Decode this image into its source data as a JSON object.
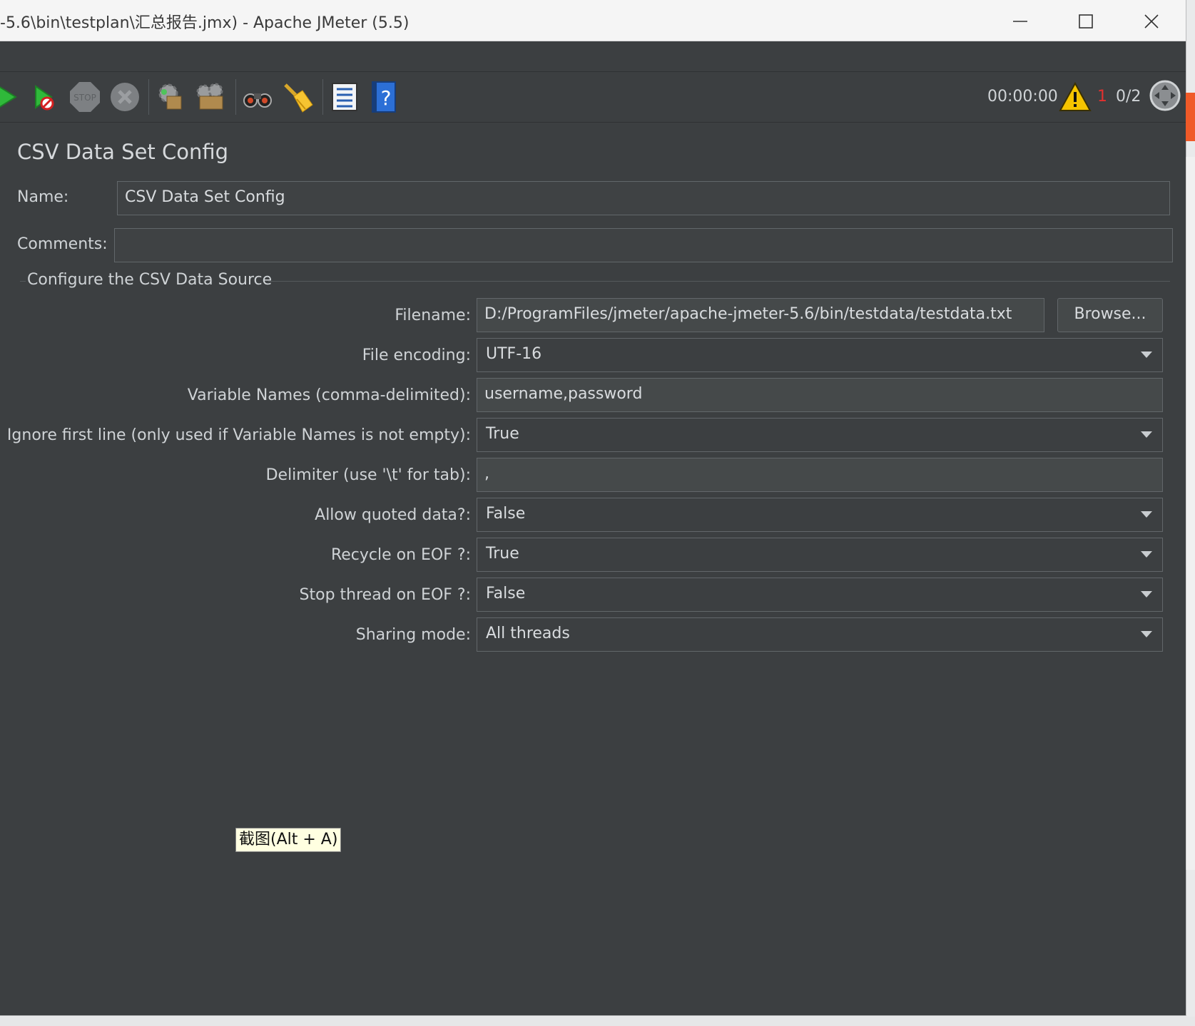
{
  "window": {
    "title": "-5.6\\bin\\testplan\\汇总报告.jmx) - Apache JMeter (5.5)",
    "controls": [
      "minimize",
      "maximize",
      "close"
    ]
  },
  "toolbar": {
    "buttons": [
      "start-icon",
      "start-no-pauses-icon",
      "stop-icon",
      "shutdown-icon",
      "clear-icon",
      "clear-all-icon",
      "search-icon",
      "reset-search-icon",
      "function-helper-icon",
      "help-icon"
    ],
    "timer": "00:00:00",
    "error_count": "1",
    "threads": "0/2"
  },
  "panel": {
    "heading": "CSV Data Set Config",
    "name_label": "Name:",
    "name_value": "CSV Data Set Config",
    "comments_label": "Comments:",
    "comments_value": "",
    "group_title": "Configure the CSV Data Source",
    "fields": {
      "filename": {
        "label": "Filename:",
        "value": "D:/ProgramFiles/jmeter/apache-jmeter-5.6/bin/testdata/testdata.txt"
      },
      "browse_label": "Browse...",
      "encoding": {
        "label": "File encoding:",
        "value": "UTF-16"
      },
      "variable_names": {
        "label": "Variable Names (comma-delimited):",
        "value": "username,password"
      },
      "ignore_first_line": {
        "label": "Ignore first line (only used if Variable Names is not empty):",
        "value": "True"
      },
      "delimiter": {
        "label": "Delimiter (use '\\t' for tab):",
        "value": ","
      },
      "allow_quoted": {
        "label": "Allow quoted data?:",
        "value": "False"
      },
      "recycle_eof": {
        "label": "Recycle on EOF ?:",
        "value": "True"
      },
      "stop_thread_eof": {
        "label": "Stop thread on EOF ?:",
        "value": "False"
      },
      "sharing_mode": {
        "label": "Sharing mode:",
        "value": "All threads"
      }
    }
  },
  "tooltip": "截图(Alt + A)",
  "colors": {
    "background": "#3c3f41",
    "field": "#45494a",
    "text": "#cfd3d6",
    "error": "#e2302f",
    "warning": "#f5c400"
  }
}
